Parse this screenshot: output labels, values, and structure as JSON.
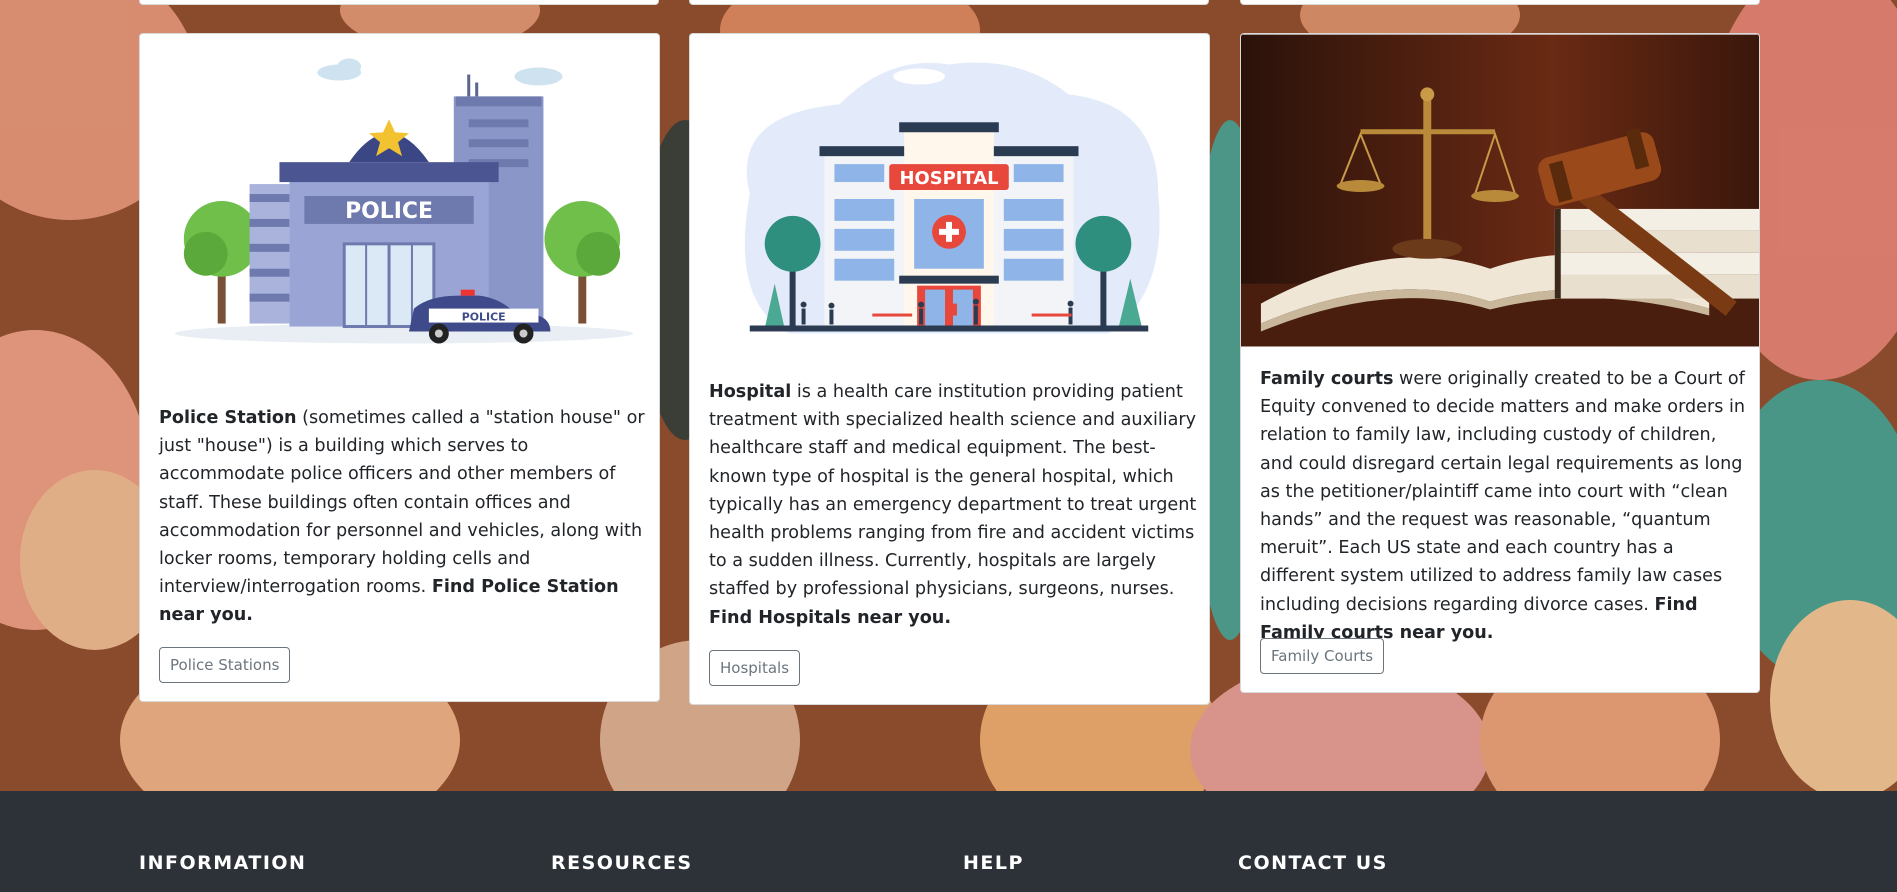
{
  "cards": [
    {
      "image_label": "POLICE",
      "car_label": "POLICE",
      "title": "Police Station",
      "body": " (sometimes called a \"station house\" or just \"house\") is a building which serves to accommodate police officers and other members of staff. These buildings often contain offices and accommodation for personnel and vehicles, along with locker rooms, temporary holding cells and interview/interrogation rooms. ",
      "cta": "Find Police Station near you.",
      "button": "Police Stations"
    },
    {
      "image_label": "HOSPITAL",
      "title": "Hospital",
      "body": " is a health care institution providing patient treatment with specialized health science and auxiliary healthcare staff and medical equipment. The best-known type of hospital is the general hospital, which typically has an emergency department to treat urgent health problems ranging from fire and accident victims to a sudden illness. Currently, hospitals are largely staffed by professional physicians, surgeons, nurses. ",
      "cta": "Find Hospitals near you.",
      "button": "Hospitals"
    },
    {
      "title": "Family courts",
      "body": " were originally created to be a Court of Equity convened to decide matters and make orders in relation to family law, including custody of children, and could disregard certain legal requirements as long as the petitioner/plaintiff came into court with “clean hands” and the request was reasonable, “quantum meruit”. Each US state and each country has a different system utilized to address family law cases including decisions regarding divorce cases. ",
      "cta": "Find Family courts near you.",
      "button": "Family Courts"
    }
  ],
  "footer": {
    "headings": [
      "INFORMATION",
      "RESOURCES",
      "HELP",
      "CONTACT US"
    ]
  },
  "colors": {
    "footer_bg": "#2d3238",
    "button_border": "#6c757d"
  }
}
